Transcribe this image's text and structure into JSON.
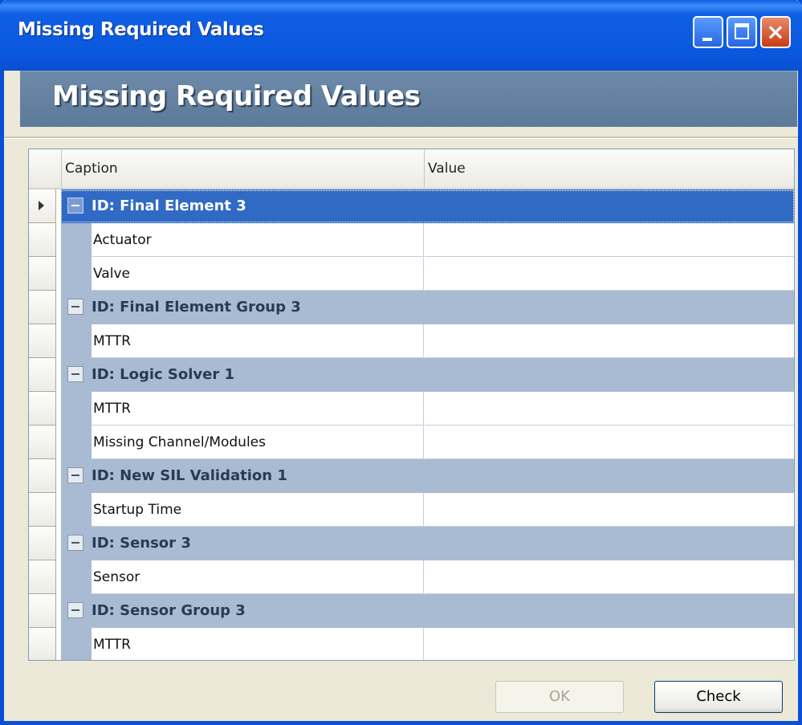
{
  "window": {
    "title": "Missing Required Values"
  },
  "header": {
    "title": "Missing Required Values"
  },
  "grid": {
    "columns": [
      "Caption",
      "Value"
    ],
    "groups": [
      {
        "label": "ID: Final Element 3",
        "selected": true,
        "items": [
          "Actuator",
          "Valve"
        ]
      },
      {
        "label": "ID: Final Element Group 3",
        "selected": false,
        "items": [
          "MTTR"
        ]
      },
      {
        "label": "ID: Logic Solver 1",
        "selected": false,
        "items": [
          "MTTR",
          "Missing Channel/Modules"
        ]
      },
      {
        "label": "ID: New SIL Validation  1",
        "selected": false,
        "items": [
          "Startup Time"
        ]
      },
      {
        "label": "ID: Sensor 3",
        "selected": false,
        "items": [
          "Sensor"
        ]
      },
      {
        "label": "ID: Sensor Group 3",
        "selected": false,
        "items": [
          "MTTR"
        ]
      }
    ]
  },
  "buttons": {
    "ok": "OK",
    "check": "Check",
    "ok_enabled": false
  },
  "colors": {
    "titlebar": "#0a58de",
    "header_panel": "#5e7a99",
    "group_band": "#a9bbd3",
    "selection": "#316ac5"
  }
}
